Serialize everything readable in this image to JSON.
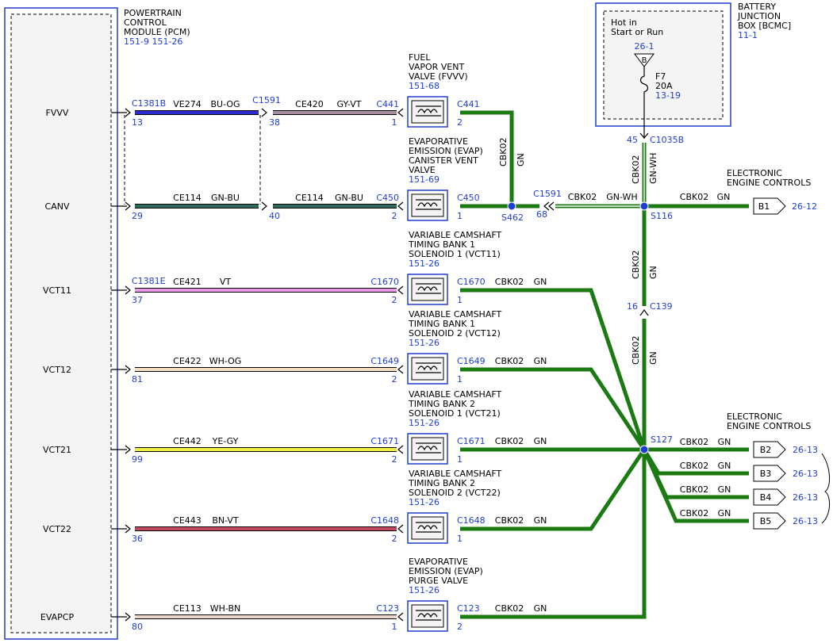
{
  "pcm": {
    "title": [
      "POWERTRAIN",
      "CONTROL",
      "MODULE (PCM)"
    ],
    "refs": "151-9  151-26",
    "pins": [
      "FVVV",
      "CANV",
      "VCT11",
      "VCT12",
      "VCT21",
      "VCT22",
      "EVAPCP"
    ]
  },
  "bjb": {
    "title": [
      "BATTERY",
      "JUNCTION",
      "BOX [BCMC]"
    ],
    "ref": "11-1",
    "hot": [
      "Hot in",
      "Start or Run"
    ],
    "fuse_ref": "26-1",
    "fuse_letter": "B",
    "fuse": [
      "F7",
      "20A",
      "13-19"
    ],
    "conn_pin": "45",
    "conn": "C1035B"
  },
  "wires": [
    {
      "c1": "C1381B",
      "p1": "13",
      "circ1": "VE274",
      "col1": "BU-OG",
      "c2": "C1591",
      "p2": "38",
      "circ2": "CE420",
      "col2": "GY-VT",
      "c3": "C441",
      "p3": "1",
      "color_a": "#2b2bd0",
      "color_b": "#a88ca0"
    },
    {
      "c1": "",
      "p1": "29",
      "circ1": "CE114",
      "col1": "GN-BU",
      "c2": "",
      "p2": "40",
      "circ2": "CE114",
      "col2": "GN-BU",
      "c3": "C450",
      "p3": "2",
      "color_a": "#2e6b5e",
      "color_b": "#2e6b5e"
    },
    {
      "c1": "C1381E",
      "p1": "37",
      "circ1": "CE421",
      "col1": "VT",
      "c2": "",
      "p2": "",
      "circ2": "",
      "col2": "",
      "c3": "C1670",
      "p3": "2",
      "color_a": "#e89ae8",
      "color_b": "#e89ae8"
    },
    {
      "c1": "",
      "p1": "81",
      "circ1": "CE422",
      "col1": "WH-OG",
      "c2": "",
      "p2": "",
      "circ2": "",
      "col2": "",
      "c3": "C1649",
      "p3": "2",
      "color_a": "#f4dcc0",
      "color_b": "#f4dcc0"
    },
    {
      "c1": "",
      "p1": "99",
      "circ1": "CE442",
      "col1": "YE-GY",
      "c2": "",
      "p2": "",
      "circ2": "",
      "col2": "",
      "c3": "C1671",
      "p3": "2",
      "color_a": "#f0ee40",
      "color_b": "#f0ee40"
    },
    {
      "c1": "",
      "p1": "36",
      "circ1": "CE443",
      "col1": "BN-VT",
      "c2": "",
      "p2": "",
      "circ2": "",
      "col2": "",
      "c3": "C1648",
      "p3": "2",
      "color_a": "#c24a5a",
      "color_b": "#c24a5a"
    },
    {
      "c1": "",
      "p1": "80",
      "circ1": "CE113",
      "col1": "WH-BN",
      "c2": "",
      "p2": "",
      "circ2": "",
      "col2": "",
      "c3": "C123",
      "p3": "1",
      "color_a": "#ecd6cc",
      "color_b": "#ecd6cc"
    }
  ],
  "components": [
    {
      "lines": [
        "FUEL",
        "VAPOR VENT",
        "VALVE (FVVV)"
      ],
      "ref": "151-68",
      "out_c": "C441",
      "out_p": "2"
    },
    {
      "lines": [
        "EVAPORATIVE",
        "EMISSION (EVAP)",
        "CANISTER VENT",
        "VALVE"
      ],
      "ref": "151-69",
      "out_c": "C450",
      "out_p": "1"
    },
    {
      "lines": [
        "VARIABLE CAMSHAFT",
        "TIMING BANK 1",
        "SOLENOID 1 (VCT11)"
      ],
      "ref": "151-26",
      "out_c": "C1670",
      "out_p": "1"
    },
    {
      "lines": [
        "VARIABLE CAMSHAFT",
        "TIMING BANK 1",
        "SOLENOID 2 (VCT12)"
      ],
      "ref": "151-26",
      "out_c": "C1649",
      "out_p": "1"
    },
    {
      "lines": [
        "VARIABLE CAMSHAFT",
        "TIMING BANK 2",
        "SOLENOID 1 (VCT21)"
      ],
      "ref": "151-26",
      "out_c": "C1671",
      "out_p": "1"
    },
    {
      "lines": [
        "VARIABLE CAMSHAFT",
        "TIMING BANK 2",
        "SOLENOID 2 (VCT22)"
      ],
      "ref": "151-26",
      "out_c": "C1648",
      "out_p": "1"
    },
    {
      "lines": [
        "EVAPORATIVE",
        "EMISSION (EVAP)",
        "PURGE VALVE"
      ],
      "ref": "151-26",
      "out_c": "C123",
      "out_p": "2"
    }
  ],
  "ground": {
    "circuit": "CBK02",
    "color": "GN",
    "color_wh": "GN-WH",
    "c1591": "C1591",
    "c1591_pin": "68",
    "c139": "C139",
    "c139_pin": "16",
    "splices": [
      "S462",
      "S116",
      "S127"
    ]
  },
  "eec1": {
    "title": [
      "ELECTRONIC",
      "ENGINE CONTROLS"
    ],
    "conn": "B1",
    "ref": "26-12"
  },
  "eec2": {
    "title": [
      "ELECTRONIC",
      "ENGINE CONTROLS"
    ],
    "items": [
      {
        "conn": "B2",
        "ref": "26-13"
      },
      {
        "conn": "B3",
        "ref": "26-13"
      },
      {
        "conn": "B4",
        "ref": "26-13"
      },
      {
        "conn": "B5",
        "ref": "26-13"
      }
    ]
  }
}
